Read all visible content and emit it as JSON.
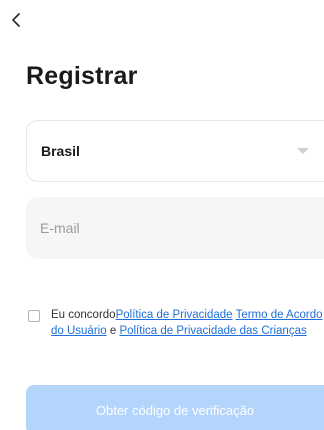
{
  "header": {
    "back_icon": "chevron-left-icon",
    "title": "Registrar"
  },
  "form": {
    "country": {
      "value": "Brasil",
      "dropdown_icon": "caret-down-icon"
    },
    "email": {
      "placeholder": "E-mail",
      "value": ""
    },
    "consent": {
      "checked": false,
      "prefix": "Eu concordo",
      "privacy_policy_link": "Política de Privacidade",
      "user_agreement_link": "Termo de Acordo do Usuário",
      "conjunction": "e",
      "children_privacy_link": "Política de Privacidade das Crianças"
    },
    "submit_label": "Obter código de verificação"
  },
  "colors": {
    "link": "#1e6fd9",
    "button_disabled_bg": "#b3d4fb",
    "input_bg": "#f5f6f8"
  }
}
